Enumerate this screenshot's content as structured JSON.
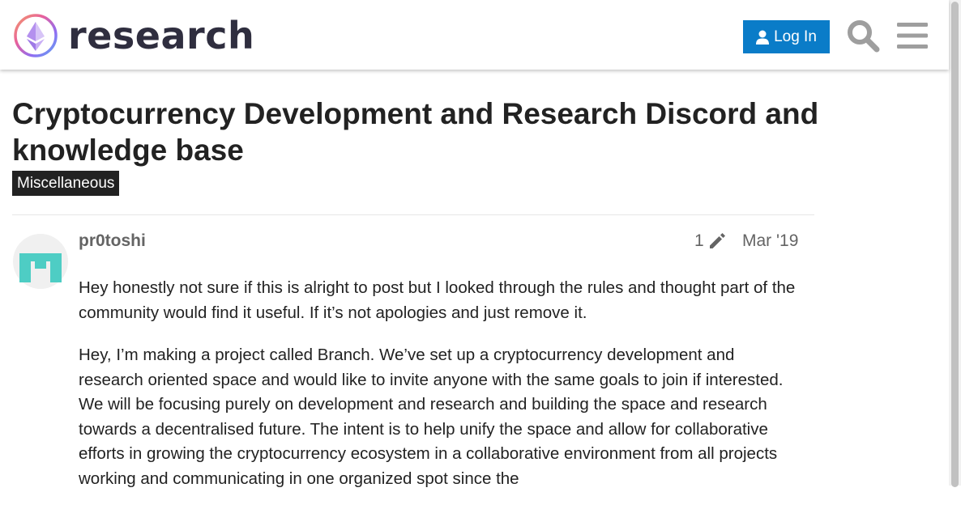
{
  "header": {
    "logo_text": "research",
    "login_label": "Log In",
    "icons": [
      "ethereum-logo",
      "user-icon",
      "search-icon",
      "hamburger-menu-icon"
    ]
  },
  "topic": {
    "title": "Cryptocurrency Development and Research Discord and knowledge base",
    "category": "Miscellaneous"
  },
  "post": {
    "username": "pr0toshi",
    "edit_count": "1",
    "date": "Mar '19",
    "paragraphs": [
      "Hey honestly not sure if this is alright to post but I looked through the rules and thought part of the community would find it useful. If it’s not apologies and just remove it.",
      "Hey, I’m making a project called Branch. We’ve set up a cryptocurrency development and research oriented space and would like to invite anyone with the same goals to join if interested. We will be focusing purely on development and research and building the space and research towards a decentralised future. The intent is to help unify the space and allow for collaborative efforts in growing the cryptocurrency ecosystem in a collaborative environment from all projects working and communicating in one organized spot since the"
    ]
  },
  "colors": {
    "primary_button": "#0a7cc8",
    "category_badge": "#222222",
    "avatar_color": "#4ecdc4"
  }
}
